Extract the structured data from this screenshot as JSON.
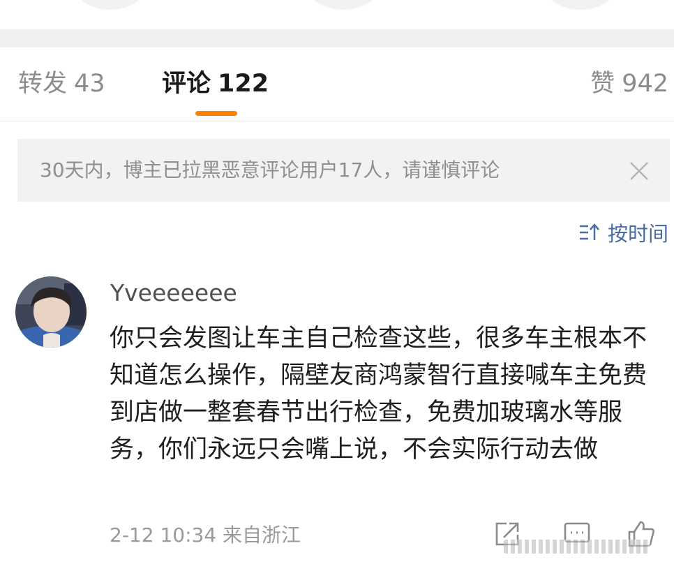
{
  "tabs": {
    "reposts": {
      "label": "转发",
      "count": "43"
    },
    "comments": {
      "label": "评论",
      "count": "122"
    },
    "likes": {
      "label": "赞",
      "count": "942"
    }
  },
  "notice": {
    "text": "30天内，博主已拉黑恶意评论用户17人，请谨慎评论"
  },
  "sort": {
    "label": "按时间",
    "icon": "sort-icon"
  },
  "comment": {
    "username": "Yveeeeeee",
    "text": "你只会发图让车主自己检查这些，很多车主根本不知道怎么操作，隔壁友商鸿蒙智行直接喊车主免费到店做一整套春节出行检查，免费加玻璃水等服务，你们永远只会嘴上说，不会实际行动去做",
    "time": "2-12 10:34",
    "location": "来自浙江",
    "actions": [
      "share-icon",
      "comment-icon",
      "like-icon"
    ]
  },
  "colors": {
    "accent": "#ff8200",
    "link": "#4a6da7",
    "muted": "#8c8c8c"
  }
}
